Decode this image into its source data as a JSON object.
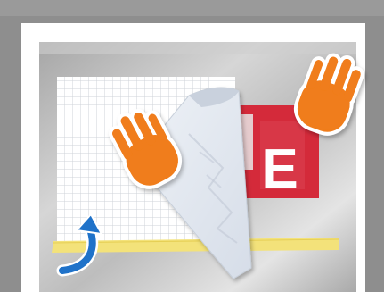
{
  "illustration": {
    "sticker_letter": "E",
    "left_hand_icon": "hand-icon",
    "right_hand_icon": "hand-icon",
    "arrow_icon": "curved-arrow-up-icon",
    "colors": {
      "outer_background": "#8d8d8d",
      "frame_white": "#ffffff",
      "metal_panel": "#b9b9b9",
      "grid_paper": "#ffffff",
      "grid_lines": "#cfd3d8",
      "transfer_sheet": "#e3e8f0",
      "sticker_red": "#d42a3a",
      "hand_orange": "#f07d1a",
      "arrow_blue": "#1f72c9",
      "tape_yellow": "#f3e27a"
    }
  }
}
